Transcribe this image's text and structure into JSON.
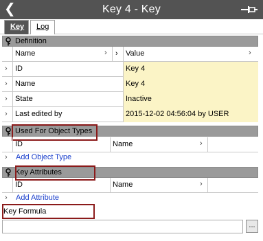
{
  "window": {
    "title": "Key 4 - Key"
  },
  "tabs": [
    {
      "label": "Key",
      "active": true
    },
    {
      "label": "Log",
      "active": false
    }
  ],
  "definition": {
    "section_label": "Definition",
    "header": {
      "name": "Name",
      "value": "Value"
    },
    "rows": [
      {
        "name": "ID",
        "value": "Key 4"
      },
      {
        "name": "Name",
        "value": "Key 4"
      },
      {
        "name": "State",
        "value": "Inactive"
      },
      {
        "name": "Last edited by",
        "value": "2015-12-02 04:56:04 by USER"
      }
    ]
  },
  "used_for": {
    "section_label": "Used For Object Types",
    "columns": {
      "id": "ID",
      "name": "Name"
    },
    "add_link": "Add Object Type"
  },
  "key_attributes": {
    "section_label": "Key Attributes",
    "columns": {
      "id": "ID",
      "name": "Name"
    },
    "add_link": "Add Attribute"
  },
  "formula": {
    "label": "Key Formula",
    "value": "",
    "browse_label": "..."
  },
  "colors": {
    "titlebar": "#535353",
    "section": "#9a9a9a",
    "yellow_cell": "#fbf4c6",
    "link": "#1a3fcc",
    "highlight": "#8b1a1a"
  },
  "icons": {
    "back": "chevron-left-icon",
    "pin": "pin-icon",
    "key": "key-icon",
    "row_expand": "chevron-right-icon"
  }
}
